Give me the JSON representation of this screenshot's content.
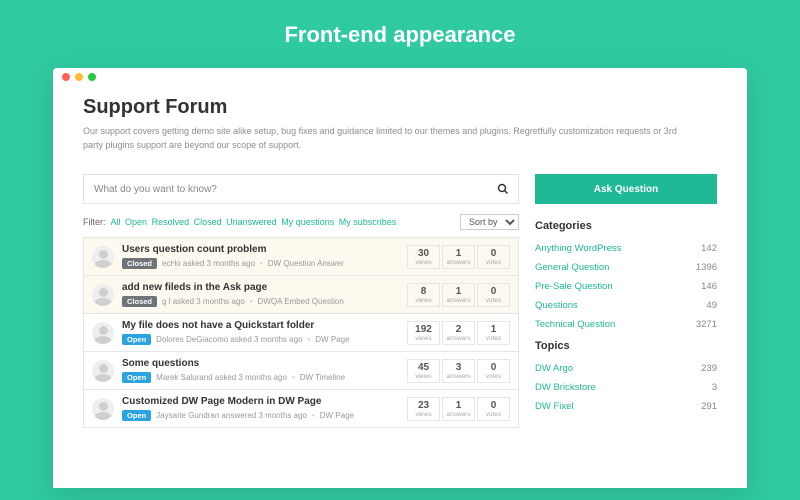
{
  "hero": {
    "title": "Front-end appearance"
  },
  "titlebar": {
    "dots": [
      "#ff5f57",
      "#febc2e",
      "#28c840"
    ]
  },
  "page": {
    "title": "Support Forum",
    "description": "Our support covers getting demo site alike setup, bug fixes and guidance limited to our themes and plugins. Regretfully customization requests or 3rd party plugins support are beyond our scope of support."
  },
  "search": {
    "placeholder": "What do you want to know?"
  },
  "filter": {
    "label": "Filter:",
    "items": [
      "All",
      "Open",
      "Resolved",
      "Closed",
      "Unanswered",
      "My questions",
      "My subscribes"
    ],
    "sort": "Sort by"
  },
  "questions": [
    {
      "title": "Users question count problem",
      "status": "Closed",
      "author": "ecHo",
      "action": "asked 3 months ago",
      "category": "DW Question Answer",
      "views": 30,
      "answers": 1,
      "votes": 0,
      "closed": true
    },
    {
      "title": "add new fileds in the Ask page",
      "status": "Closed",
      "author": "g l",
      "action": "asked 3 months ago",
      "category": "DWQA Embed Question",
      "views": 8,
      "answers": 1,
      "votes": 0,
      "closed": true
    },
    {
      "title": "My file does not have a Quickstart folder",
      "status": "Open",
      "author": "Dolores DeGiacomo",
      "action": "asked 3 months ago",
      "category": "DW Page",
      "views": 192,
      "answers": 2,
      "votes": 1,
      "closed": false
    },
    {
      "title": "Some questions",
      "status": "Open",
      "author": "Marek Salurand",
      "action": "asked 3 months ago",
      "category": "DW Timeline",
      "views": 45,
      "answers": 3,
      "votes": 0,
      "closed": false
    },
    {
      "title": "Customized DW Page Modern in DW Page",
      "status": "Open",
      "author": "Jaysarie Gundran",
      "action": "answered 3 months ago",
      "category": "DW Page",
      "views": 23,
      "answers": 1,
      "votes": 0,
      "closed": false
    }
  ],
  "stat_labels": {
    "views": "views",
    "answers": "answers",
    "votes": "votes"
  },
  "sidebar": {
    "ask": "Ask Question",
    "categories_h": "Categories",
    "categories": [
      {
        "name": "Anything WordPress",
        "count": 142
      },
      {
        "name": "General Question",
        "count": 1396
      },
      {
        "name": "Pre-Sale Question",
        "count": 146
      },
      {
        "name": "Questions",
        "count": 49
      },
      {
        "name": "Technical Question",
        "count": 3271
      }
    ],
    "topics_h": "Topics",
    "topics": [
      {
        "name": "DW Argo",
        "count": 239
      },
      {
        "name": "DW Brickstore",
        "count": 3
      },
      {
        "name": "DW Fixel",
        "count": 291
      }
    ]
  }
}
